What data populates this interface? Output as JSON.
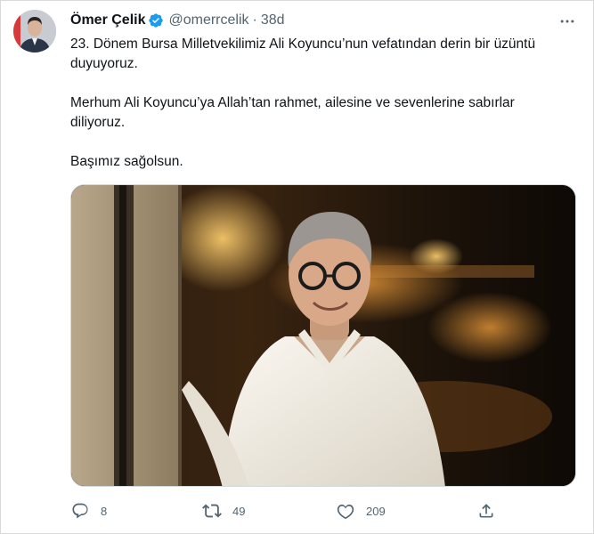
{
  "tweet": {
    "author_name": "Ömer Çelik",
    "handle": "@omerrcelik",
    "separator": "·",
    "time": "38d",
    "paragraphs": [
      "23. Dönem Bursa Milletvekilimiz Ali Koyuncu’nun vefatından derin bir üzüntü duyuyoruz.",
      "Merhum Ali Koyuncu’ya Allah’tan rahmet, ailesine ve sevenlerine sabırlar diliyoruz.",
      "Başımız sağolsun."
    ],
    "verified_icon": "verified-badge-icon",
    "more_icon": "more-dots-icon"
  },
  "actions": {
    "reply_count": "8",
    "retweet_count": "49",
    "like_count": "209"
  },
  "colors": {
    "accent": "#1d9bf0",
    "secondary_text": "#536471",
    "primary_text": "#0f1419"
  }
}
